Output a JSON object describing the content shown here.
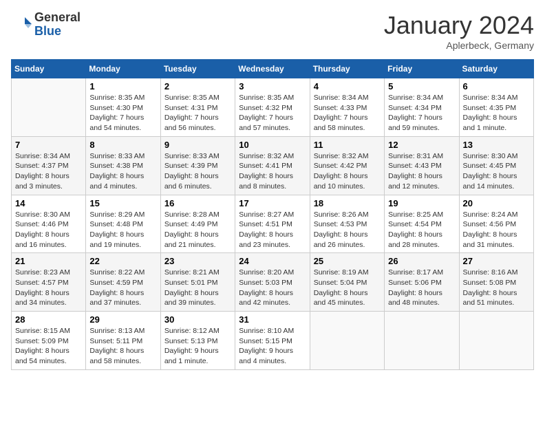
{
  "logo": {
    "general": "General",
    "blue": "Blue"
  },
  "calendar": {
    "title": "January 2024",
    "subtitle": "Aplerbeck, Germany"
  },
  "weekdays": [
    "Sunday",
    "Monday",
    "Tuesday",
    "Wednesday",
    "Thursday",
    "Friday",
    "Saturday"
  ],
  "weeks": [
    [
      {
        "day": "",
        "info": ""
      },
      {
        "day": "1",
        "info": "Sunrise: 8:35 AM\nSunset: 4:30 PM\nDaylight: 7 hours\nand 54 minutes."
      },
      {
        "day": "2",
        "info": "Sunrise: 8:35 AM\nSunset: 4:31 PM\nDaylight: 7 hours\nand 56 minutes."
      },
      {
        "day": "3",
        "info": "Sunrise: 8:35 AM\nSunset: 4:32 PM\nDaylight: 7 hours\nand 57 minutes."
      },
      {
        "day": "4",
        "info": "Sunrise: 8:34 AM\nSunset: 4:33 PM\nDaylight: 7 hours\nand 58 minutes."
      },
      {
        "day": "5",
        "info": "Sunrise: 8:34 AM\nSunset: 4:34 PM\nDaylight: 7 hours\nand 59 minutes."
      },
      {
        "day": "6",
        "info": "Sunrise: 8:34 AM\nSunset: 4:35 PM\nDaylight: 8 hours\nand 1 minute."
      }
    ],
    [
      {
        "day": "7",
        "info": "Sunrise: 8:34 AM\nSunset: 4:37 PM\nDaylight: 8 hours\nand 3 minutes."
      },
      {
        "day": "8",
        "info": "Sunrise: 8:33 AM\nSunset: 4:38 PM\nDaylight: 8 hours\nand 4 minutes."
      },
      {
        "day": "9",
        "info": "Sunrise: 8:33 AM\nSunset: 4:39 PM\nDaylight: 8 hours\nand 6 minutes."
      },
      {
        "day": "10",
        "info": "Sunrise: 8:32 AM\nSunset: 4:41 PM\nDaylight: 8 hours\nand 8 minutes."
      },
      {
        "day": "11",
        "info": "Sunrise: 8:32 AM\nSunset: 4:42 PM\nDaylight: 8 hours\nand 10 minutes."
      },
      {
        "day": "12",
        "info": "Sunrise: 8:31 AM\nSunset: 4:43 PM\nDaylight: 8 hours\nand 12 minutes."
      },
      {
        "day": "13",
        "info": "Sunrise: 8:30 AM\nSunset: 4:45 PM\nDaylight: 8 hours\nand 14 minutes."
      }
    ],
    [
      {
        "day": "14",
        "info": "Sunrise: 8:30 AM\nSunset: 4:46 PM\nDaylight: 8 hours\nand 16 minutes."
      },
      {
        "day": "15",
        "info": "Sunrise: 8:29 AM\nSunset: 4:48 PM\nDaylight: 8 hours\nand 19 minutes."
      },
      {
        "day": "16",
        "info": "Sunrise: 8:28 AM\nSunset: 4:49 PM\nDaylight: 8 hours\nand 21 minutes."
      },
      {
        "day": "17",
        "info": "Sunrise: 8:27 AM\nSunset: 4:51 PM\nDaylight: 8 hours\nand 23 minutes."
      },
      {
        "day": "18",
        "info": "Sunrise: 8:26 AM\nSunset: 4:53 PM\nDaylight: 8 hours\nand 26 minutes."
      },
      {
        "day": "19",
        "info": "Sunrise: 8:25 AM\nSunset: 4:54 PM\nDaylight: 8 hours\nand 28 minutes."
      },
      {
        "day": "20",
        "info": "Sunrise: 8:24 AM\nSunset: 4:56 PM\nDaylight: 8 hours\nand 31 minutes."
      }
    ],
    [
      {
        "day": "21",
        "info": "Sunrise: 8:23 AM\nSunset: 4:57 PM\nDaylight: 8 hours\nand 34 minutes."
      },
      {
        "day": "22",
        "info": "Sunrise: 8:22 AM\nSunset: 4:59 PM\nDaylight: 8 hours\nand 37 minutes."
      },
      {
        "day": "23",
        "info": "Sunrise: 8:21 AM\nSunset: 5:01 PM\nDaylight: 8 hours\nand 39 minutes."
      },
      {
        "day": "24",
        "info": "Sunrise: 8:20 AM\nSunset: 5:03 PM\nDaylight: 8 hours\nand 42 minutes."
      },
      {
        "day": "25",
        "info": "Sunrise: 8:19 AM\nSunset: 5:04 PM\nDaylight: 8 hours\nand 45 minutes."
      },
      {
        "day": "26",
        "info": "Sunrise: 8:17 AM\nSunset: 5:06 PM\nDaylight: 8 hours\nand 48 minutes."
      },
      {
        "day": "27",
        "info": "Sunrise: 8:16 AM\nSunset: 5:08 PM\nDaylight: 8 hours\nand 51 minutes."
      }
    ],
    [
      {
        "day": "28",
        "info": "Sunrise: 8:15 AM\nSunset: 5:09 PM\nDaylight: 8 hours\nand 54 minutes."
      },
      {
        "day": "29",
        "info": "Sunrise: 8:13 AM\nSunset: 5:11 PM\nDaylight: 8 hours\nand 58 minutes."
      },
      {
        "day": "30",
        "info": "Sunrise: 8:12 AM\nSunset: 5:13 PM\nDaylight: 9 hours\nand 1 minute."
      },
      {
        "day": "31",
        "info": "Sunrise: 8:10 AM\nSunset: 5:15 PM\nDaylight: 9 hours\nand 4 minutes."
      },
      {
        "day": "",
        "info": ""
      },
      {
        "day": "",
        "info": ""
      },
      {
        "day": "",
        "info": ""
      }
    ]
  ]
}
